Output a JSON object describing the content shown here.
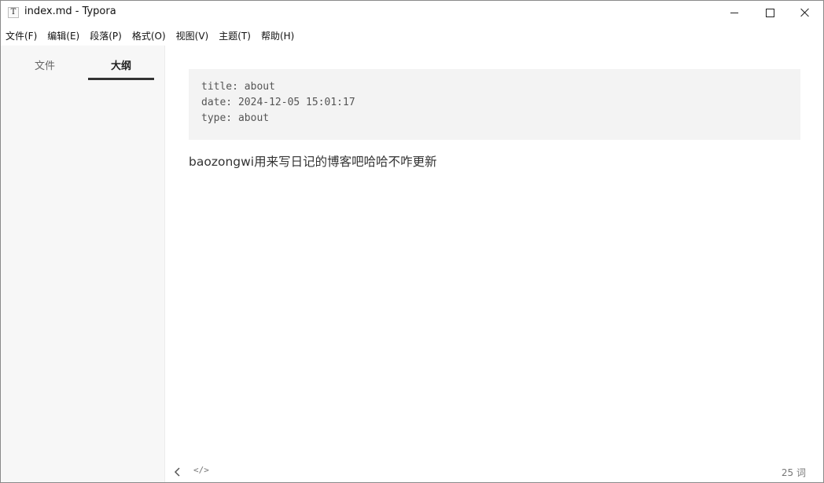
{
  "window": {
    "title": "index.md - Typora",
    "app_icon_letter": "T"
  },
  "menu": {
    "items": [
      {
        "label": "文件(F)"
      },
      {
        "label": "编辑(E)"
      },
      {
        "label": "段落(P)"
      },
      {
        "label": "格式(O)"
      },
      {
        "label": "视图(V)"
      },
      {
        "label": "主题(T)"
      },
      {
        "label": "帮助(H)"
      }
    ]
  },
  "sidebar": {
    "tabs": [
      {
        "label": "文件",
        "active": false
      },
      {
        "label": "大纲",
        "active": true
      }
    ]
  },
  "editor": {
    "front_matter": [
      "title: about",
      "date: 2024-12-05 15:01:17",
      "type: about"
    ],
    "paragraph": "baozongwi用来写日记的博客吧哈哈不咋更新"
  },
  "statusbar": {
    "code_toggle": "</>",
    "word_count": "25 词"
  }
}
